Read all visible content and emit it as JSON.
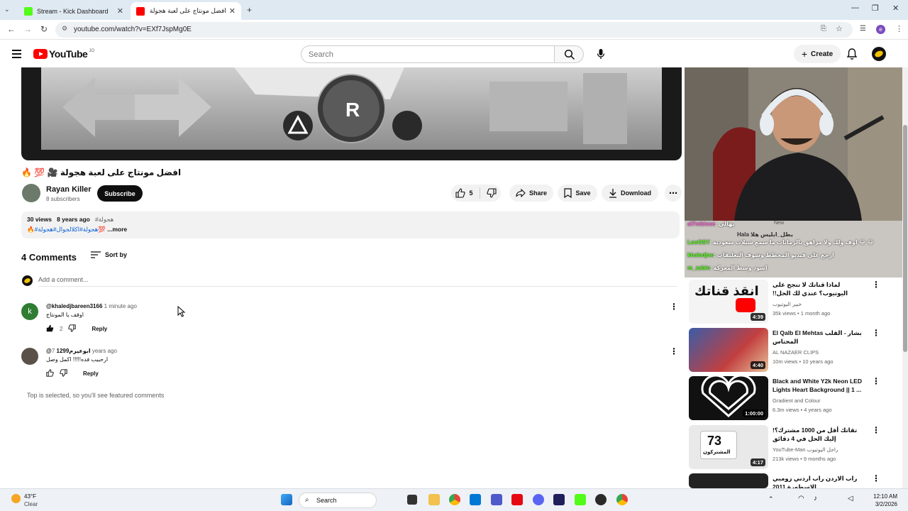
{
  "browser": {
    "tabs": [
      {
        "title": "Stream - Kick Dashboard",
        "active": false
      },
      {
        "title": "افضل مونتاج على لعبة هجولة 🎥 !",
        "active": true
      }
    ],
    "url": "youtube.com/watch?v=EXf7JspMg0E",
    "profile_initial": "e"
  },
  "header": {
    "logo": "YouTube",
    "country": "JO",
    "search_placeholder": "Search",
    "create_label": "Create"
  },
  "video": {
    "title": "افضل مونتاج على لعبة هجولة 🎥 💯 🔥",
    "channel": "Rayan Killer",
    "subscribers": "8 subscribers",
    "subscribe_label": "Subscribe",
    "likes": "5",
    "share_label": "Share",
    "save_label": "Save",
    "download_label": "Download",
    "views": "30 views",
    "age": "8 years ago",
    "hashtag": "#هجولة",
    "desc_line": "🔥#هجولة#اكلالجوال#هجولة💯",
    "more_label": "...more",
    "speedo_gear": "R"
  },
  "comments": {
    "header": "4 Comments",
    "sort_label": "Sort by",
    "add_placeholder": "Add a comment...",
    "items": [
      {
        "user": "@khaledjbareen3166",
        "time": "1 minute ago",
        "text": "اوقف يا المونتاج",
        "likes": "2",
        "reply": "Reply",
        "avatar_letter": "k",
        "avatar_color": "#2e7d32"
      },
      {
        "user": "@ابوعيرم1299",
        "time": "7 years ago",
        "text": "ارحبيب فده!!!!! اكمل وصل",
        "likes": "",
        "reply": "Reply",
        "avatar_letter": "",
        "avatar_color": "#5a5248"
      }
    ],
    "note": "Top is selected, so you'll see featured comments"
  },
  "stream_overlay": {
    "new_label": "New",
    "chat": [
      {
        "user": "al7mbiose",
        "msg": "يهالي"
      },
      {
        "user": "Hala",
        "msg": "بطل_ابليس هلا"
      },
      {
        "user": "LooOSY",
        "msg": "اوف ولك ولا مراهق بالرمانات ما سمع شيلات سعودية 😂 😂"
      },
      {
        "user": "khaledjne",
        "msg": "ارجع على فيديو المخطط وشوف التعليقات"
      },
      {
        "user": "m_zabin",
        "msg": "اسود وسط المعركة"
      }
    ]
  },
  "related": [
    {
      "title": "لماذا قناتك لا تنجح على اليوتيوب؟ عندي لك الحل!!",
      "channel": "خبير اليوتيوب",
      "meta": "35k views • 1 month ago",
      "duration": "4:39",
      "thumb_text": "انقذ قناتك",
      "rtl": true
    },
    {
      "title": "El Qalb El Mehtas بشار - القلب المحتاس",
      "channel": "AL NAZAER CLIPS",
      "meta": "10m views • 10 years ago",
      "duration": "4:40",
      "thumb_text": "",
      "rtl": false
    },
    {
      "title": "Black and White Y2k Neon LED Lights Heart Background || 1 ...",
      "channel": "Gradient and Colour",
      "meta": "6.3m views • 4 years ago",
      "duration": "1:00:00",
      "thumb_text": "",
      "rtl": false
    },
    {
      "title": "تقاتك أقل من 1000 مشترك؟! إليك الحل في 4 دقائق",
      "channel": "YouTube-Man راجل اليوتيوب",
      "meta": "213k views • 9 months ago",
      "duration": "4:17",
      "thumb_text": "73",
      "thumb_sub": "المشتركون",
      "rtl": true
    },
    {
      "title": "راب الاردن راب اردني زومبي الاسطورة 2011",
      "channel": "",
      "meta": "",
      "duration": "",
      "thumb_text": "",
      "rtl": true
    }
  ],
  "taskbar": {
    "temp": "43°F",
    "condition": "Clear",
    "search_label": "Search",
    "time": "12:10 AM",
    "date": "3/2/2026"
  }
}
